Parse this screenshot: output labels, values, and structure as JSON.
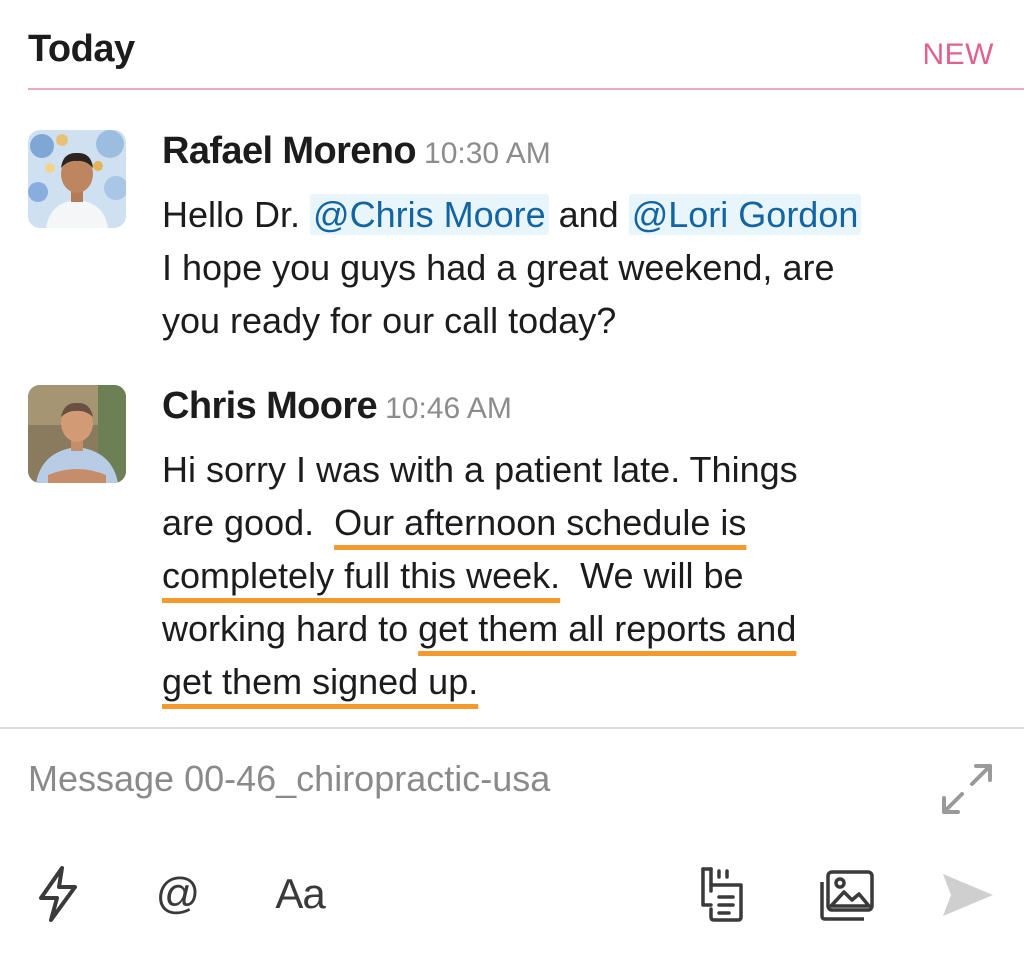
{
  "header": {
    "title": "Today",
    "badge": "NEW"
  },
  "messages": [
    {
      "author": "Rafael Moreno",
      "time": "10:30 AM",
      "lines": {
        "l1_prefix": "Hello Dr. ",
        "mention1": "@Chris Moore",
        "l1_mid": " and ",
        "mention2": "@Lori Gordon",
        "l2": "I hope you guys had a great weekend, are",
        "l3": "you ready for our call today?"
      }
    },
    {
      "author": "Chris Moore",
      "time": "10:46 AM",
      "lines": {
        "l1": "Hi sorry I was with a patient late.  Things",
        "l2_prefix": "are good.  ",
        "l2_hl": "Our afternoon schedule is",
        "l3_hl": "completely full this week.",
        "l3_suffix": "  We will be",
        "l4_prefix": "working hard to ",
        "l4_hl": "get them all reports and",
        "l5_hl": "get them signed up."
      }
    }
  ],
  "composer": {
    "placeholder": "Message 00-46_chiropractic-usa",
    "at_label": "@",
    "format_label": "Aa"
  },
  "icons": {
    "shortcuts": "lightning-icon",
    "mention": "at-icon",
    "format": "text-format-icon",
    "files": "file-icon",
    "image": "image-icon",
    "send": "send-icon",
    "expand": "expand-icon"
  },
  "colors": {
    "badge": "#e0608e",
    "divider": "#e8a9c1",
    "mention": "#1264a3",
    "mention_bg": "#e8f5fa",
    "highlight_underline": "#f39a2b"
  }
}
